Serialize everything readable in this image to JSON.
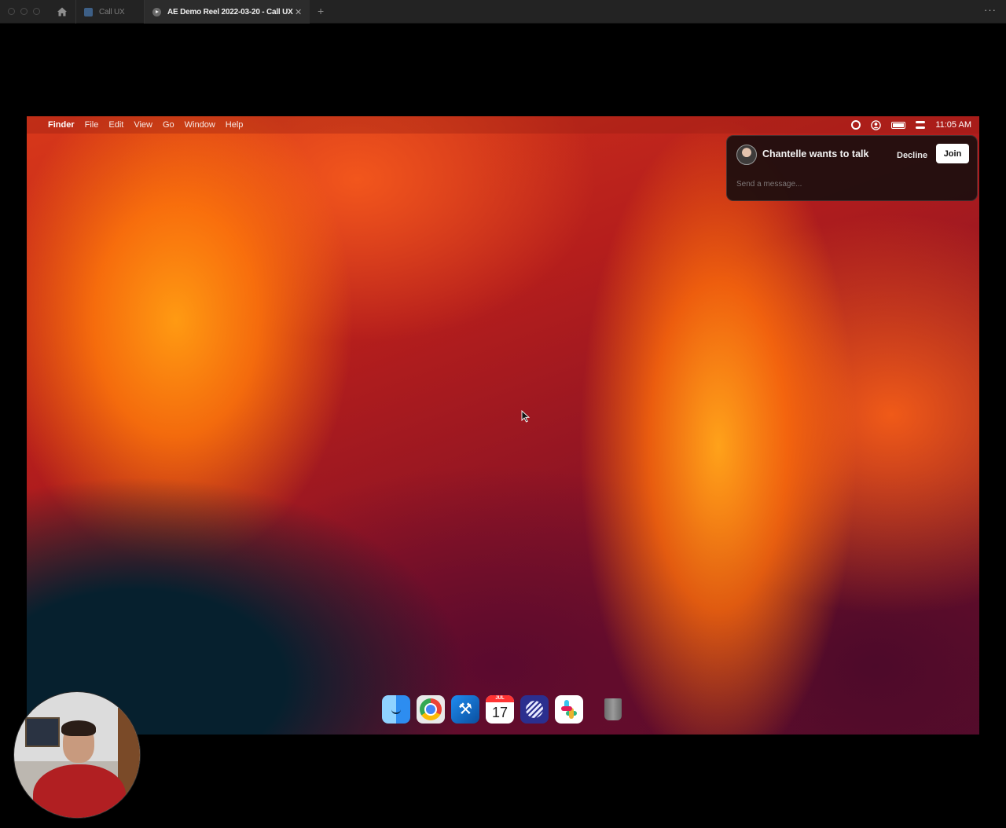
{
  "browser": {
    "tabs": [
      {
        "label": "Call UX"
      },
      {
        "label": "AE Demo Reel 2022-03-20 - Call UX"
      }
    ],
    "new_tab_label": "+",
    "close_tab_glyph": "✕",
    "more_glyph": "···"
  },
  "mac": {
    "apple_glyph": "",
    "menu": [
      "Finder",
      "File",
      "Edit",
      "View",
      "Go",
      "Window",
      "Help"
    ],
    "clock": "11:05 AM",
    "status_icons": [
      "screen-record-icon",
      "user-icon",
      "battery-icon",
      "control-center-icon"
    ]
  },
  "notification": {
    "title": "Chantelle wants to talk",
    "decline_label": "Decline",
    "join_label": "Join",
    "message_placeholder": "Send a message..."
  },
  "dock": {
    "apps": [
      "Finder",
      "Google Chrome",
      "Xcode",
      "Calendar",
      "Linear",
      "Slack",
      "Trash"
    ],
    "calendar_month": "JUL",
    "calendar_day": "17"
  },
  "colors": {
    "wallpaper_orange": "#ff9a12",
    "wallpaper_red": "#b51e1c",
    "wallpaper_plum": "#5a0d2c",
    "join_button_bg": "#ffffff"
  }
}
